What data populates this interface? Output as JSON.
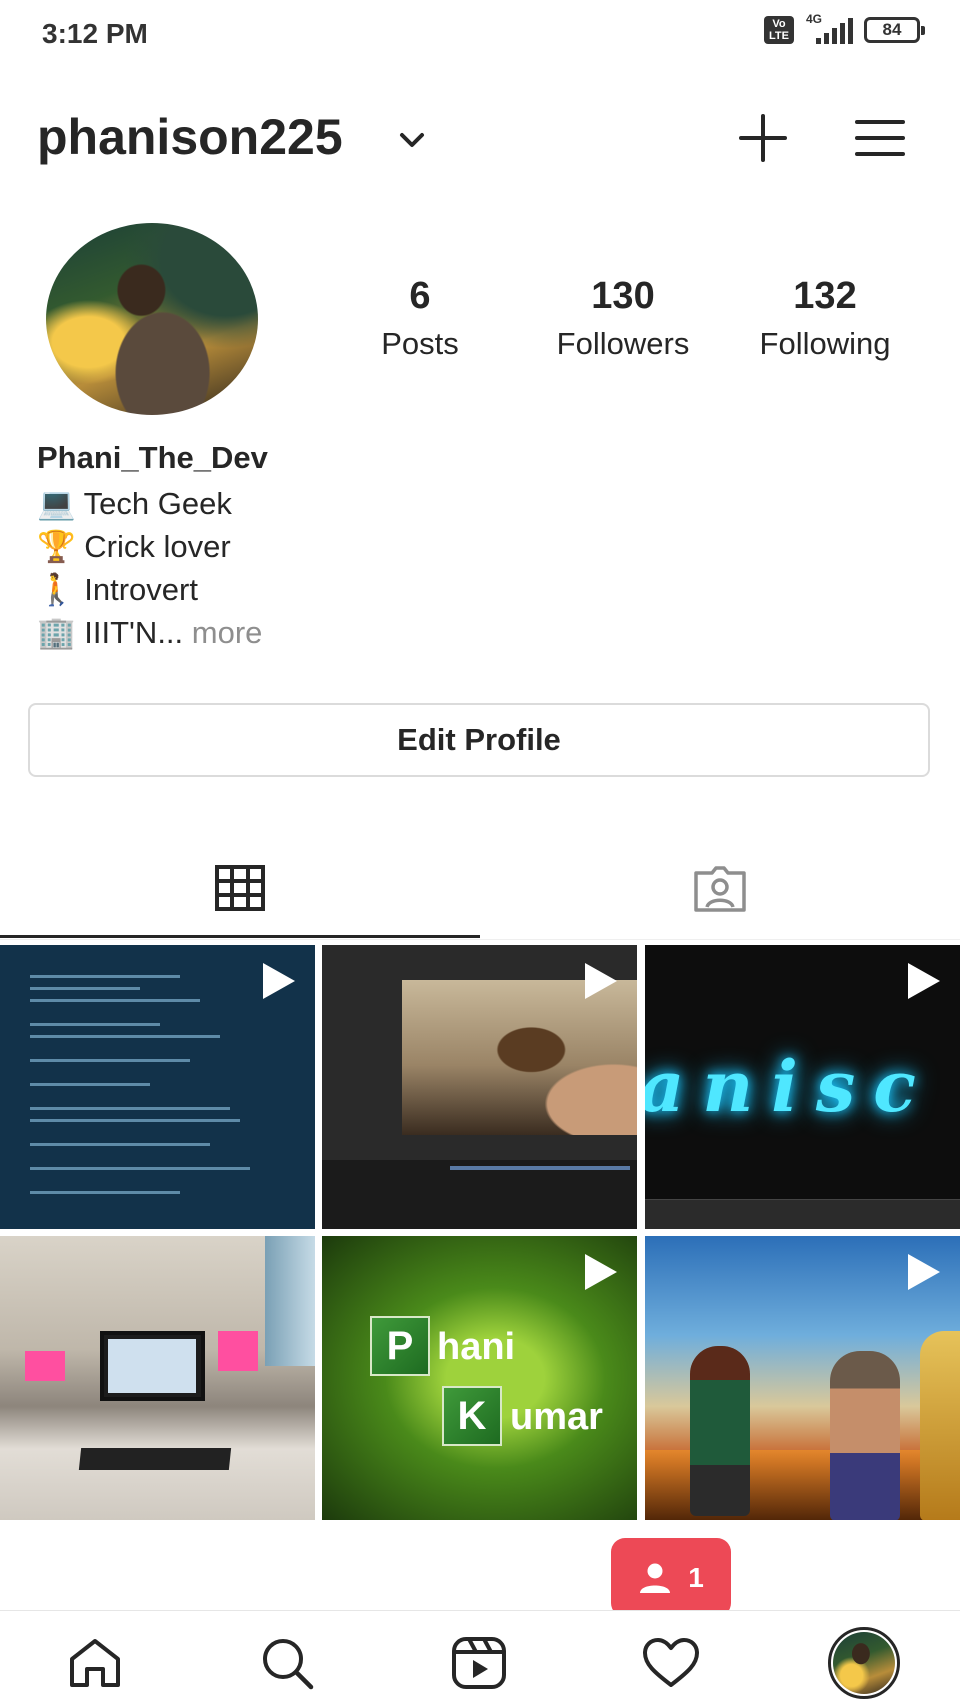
{
  "status_bar": {
    "time": "3:12 PM",
    "volte_top": "Vo",
    "volte_bottom": "LTE",
    "network": "4G",
    "battery": "84"
  },
  "header": {
    "username": "phanison225"
  },
  "profile": {
    "stats": [
      {
        "value": "6",
        "label": "Posts"
      },
      {
        "value": "130",
        "label": "Followers"
      },
      {
        "value": "132",
        "label": "Following"
      }
    ],
    "display_name": "Phani_The_Dev",
    "bio_lines": [
      {
        "emoji": "💻",
        "text": "Tech Geek"
      },
      {
        "emoji": "🏆",
        "text": "Crick lover"
      },
      {
        "emoji": "🚶",
        "text": "Introvert"
      },
      {
        "emoji": "🏢",
        "text": "IIIT'N..."
      }
    ],
    "bio_more": "more",
    "edit_button": "Edit Profile"
  },
  "tabs": [
    {
      "icon": "grid-icon",
      "selected": true
    },
    {
      "icon": "tagged-icon",
      "selected": false
    }
  ],
  "posts": [
    {
      "type": "video",
      "subject": "code-editor"
    },
    {
      "type": "video",
      "subject": "video-editing"
    },
    {
      "type": "video",
      "subject": "neon-name"
    },
    {
      "type": "image",
      "subject": "office-desk"
    },
    {
      "type": "video",
      "subject": "phani-kumar-title"
    },
    {
      "type": "video",
      "subject": "anime-characters"
    }
  ],
  "post_text": {
    "neon": "anisc",
    "bb_tile1": "P",
    "bb_word1": "hani",
    "bb_tile2": "K",
    "bb_word2": "umar"
  },
  "activity_toast": {
    "count": "1",
    "icon": "follower-icon"
  },
  "bottom_nav": [
    {
      "icon": "home-icon"
    },
    {
      "icon": "search-icon"
    },
    {
      "icon": "reels-icon"
    },
    {
      "icon": "heart-icon"
    },
    {
      "icon": "profile-avatar"
    }
  ],
  "colors": {
    "text": "#262626",
    "muted": "#8e8e8e",
    "border": "#dbdbdb",
    "badge": "#ed4956"
  }
}
